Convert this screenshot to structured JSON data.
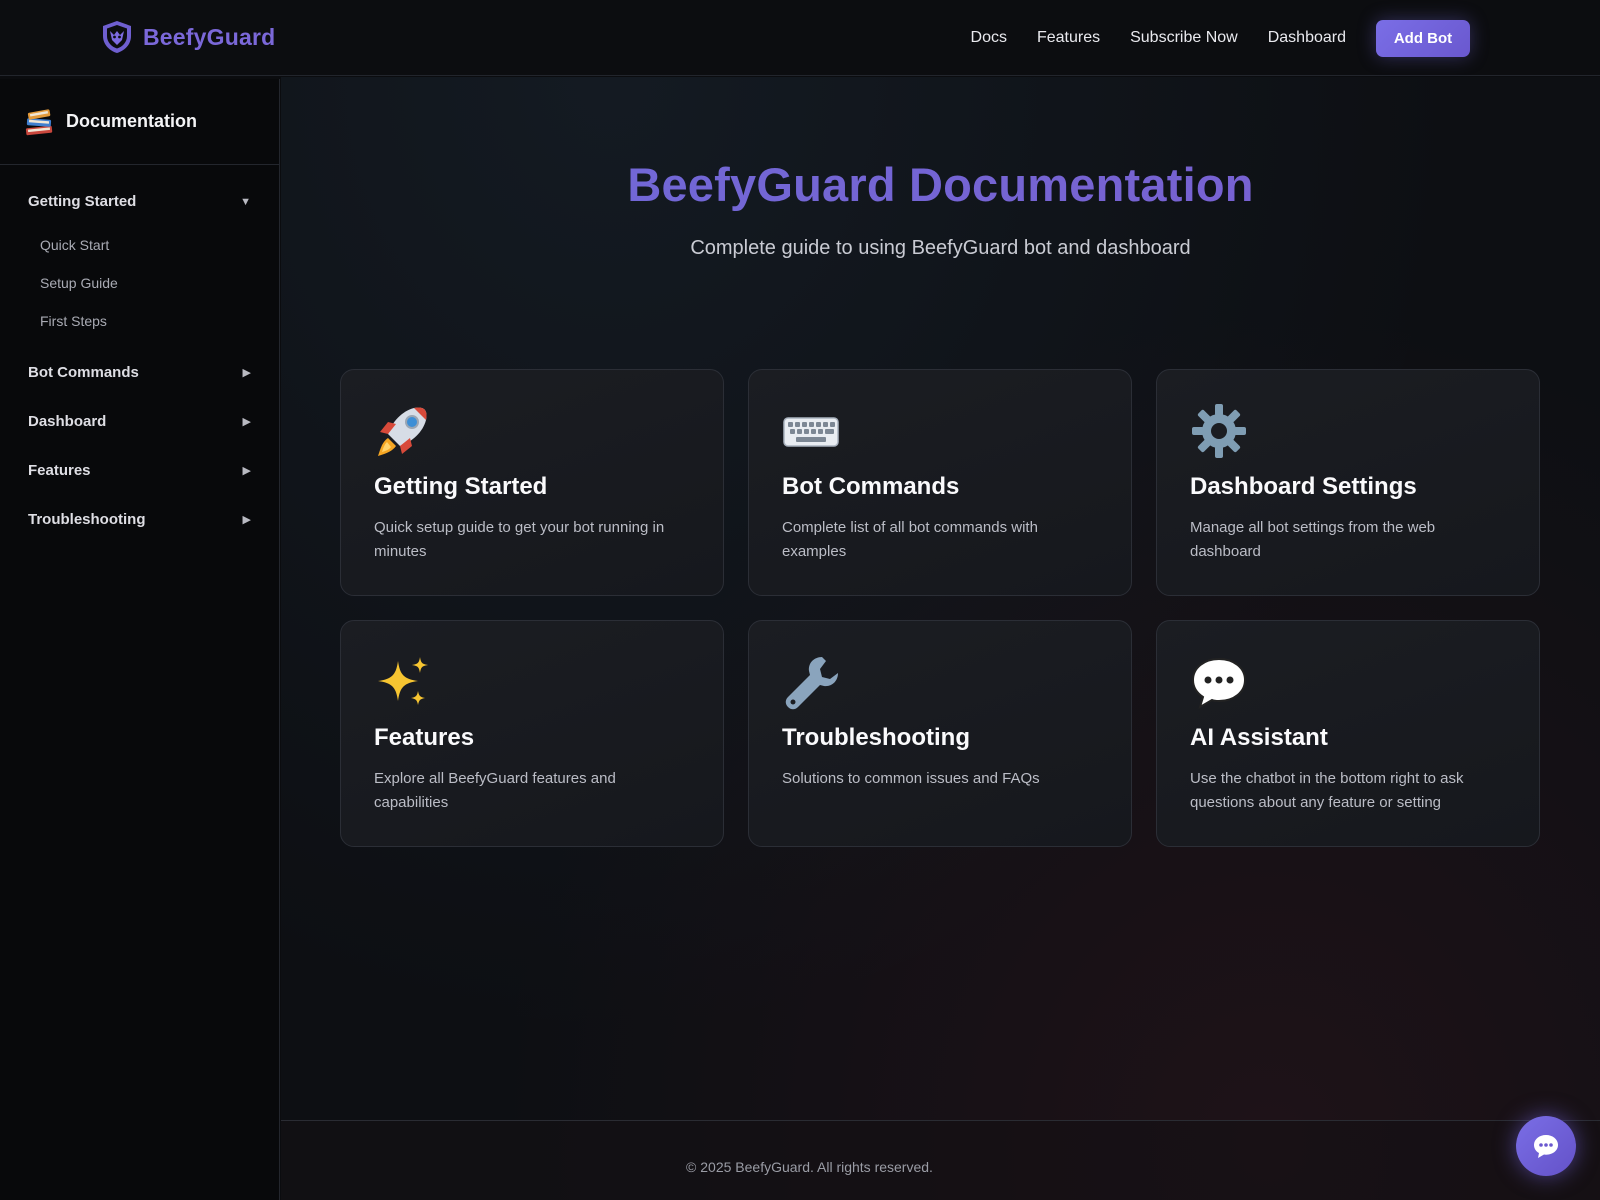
{
  "brand": {
    "name": "BeefyGuard",
    "logo_icon": "shield-icon"
  },
  "nav": {
    "links": [
      "Docs",
      "Features",
      "Subscribe Now",
      "Dashboard"
    ],
    "cta_label": "Add Bot"
  },
  "sidebar": {
    "icon": "books-icon",
    "title": "Documentation",
    "sections": [
      {
        "label": "Getting Started",
        "expanded": true,
        "arrow": "▼",
        "items": [
          "Quick Start",
          "Setup Guide",
          "First Steps"
        ]
      },
      {
        "label": "Bot Commands",
        "expanded": false,
        "arrow": "▶"
      },
      {
        "label": "Dashboard",
        "expanded": false,
        "arrow": "▶"
      },
      {
        "label": "Features",
        "expanded": false,
        "arrow": "▶"
      },
      {
        "label": "Troubleshooting",
        "expanded": false,
        "arrow": "▶"
      }
    ]
  },
  "hero": {
    "title": "BeefyGuard Documentation",
    "subtitle": "Complete guide to using BeefyGuard bot and dashboard"
  },
  "cards": [
    {
      "icon": "rocket-icon",
      "title": "Getting Started",
      "desc": "Quick setup guide to get your bot running in minutes"
    },
    {
      "icon": "keyboard-icon",
      "title": "Bot Commands",
      "desc": "Complete list of all bot commands with examples"
    },
    {
      "icon": "gear-icon",
      "title": "Dashboard Settings",
      "desc": "Manage all bot settings from the web dashboard"
    },
    {
      "icon": "sparkles-icon",
      "title": "Features",
      "desc": "Explore all BeefyGuard features and capabilities"
    },
    {
      "icon": "wrench-icon",
      "title": "Troubleshooting",
      "desc": "Solutions to common issues and FAQs"
    },
    {
      "icon": "speech-bubble-icon",
      "title": "AI Assistant",
      "desc": "Use the chatbot in the bottom right to ask questions about any feature or setting"
    }
  ],
  "footer": {
    "copyright": "© 2025 BeefyGuard. All rights reserved."
  },
  "colors": {
    "accent": "#7565d4",
    "background": "#0d0f13",
    "card": "#1b1d22"
  }
}
